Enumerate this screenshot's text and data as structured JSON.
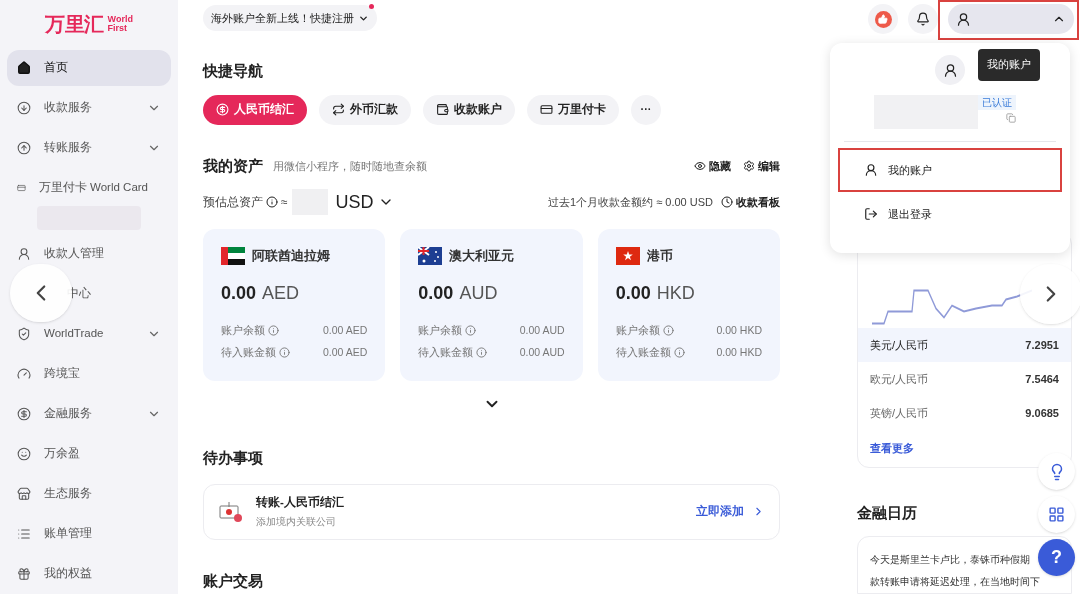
{
  "logo": {
    "brand": "万里汇",
    "sub_lines": [
      "World",
      "First"
    ]
  },
  "sidebar": {
    "items": [
      {
        "label": "首页",
        "kind": "plain",
        "selected": true,
        "expandable": false
      },
      {
        "label": "收款服务",
        "kind": "plain",
        "selected": false,
        "expandable": true
      },
      {
        "label": "转账服务",
        "kind": "plain",
        "selected": false,
        "expandable": true
      },
      {
        "label": "万里付卡 World Card",
        "kind": "redacted",
        "selected": false,
        "expandable": false
      },
      {
        "label": "收款人管理",
        "kind": "plain",
        "selected": false,
        "expandable": false
      },
      {
        "label": "中心",
        "kind": "covered",
        "selected": false,
        "expandable": false
      },
      {
        "label": "WorldTrade",
        "kind": "plain",
        "selected": false,
        "expandable": true
      },
      {
        "label": "跨境宝",
        "kind": "plain",
        "selected": false,
        "expandable": false
      },
      {
        "label": "金融服务",
        "kind": "plain",
        "selected": false,
        "expandable": true
      },
      {
        "label": "万余盈",
        "kind": "plain",
        "selected": false,
        "expandable": false
      },
      {
        "label": "生态服务",
        "kind": "plain",
        "selected": false,
        "expandable": false
      },
      {
        "label": "账单管理",
        "kind": "plain",
        "selected": false,
        "expandable": false
      },
      {
        "label": "我的权益",
        "kind": "plain",
        "selected": false,
        "expandable": false
      }
    ]
  },
  "notice": {
    "text": "海外账户全新上线！快捷注册",
    "unread": true
  },
  "account_menu": {
    "expanded": true,
    "tooltip": "我的账户",
    "verified": "已认证",
    "items": [
      {
        "label": "我的账户",
        "highlighted": true
      },
      {
        "label": "退出登录",
        "highlighted": false
      }
    ]
  },
  "quick_nav": {
    "title": "快捷导航",
    "more": "···",
    "items": [
      {
        "label": "人民币结汇",
        "selected": true
      },
      {
        "label": "外币汇款",
        "selected": false
      },
      {
        "label": "收款账户",
        "selected": false
      },
      {
        "label": "万里付卡",
        "selected": false
      }
    ]
  },
  "assets": {
    "title": "我的资产",
    "hint": "用微信小程序，随时随地查余额",
    "actions": [
      "隐藏",
      "编辑"
    ],
    "total_label": "预估总资产",
    "approx": "≈",
    "currency": "USD",
    "monthly": "过去1个月收款金额约 ≈ 0.00 USD",
    "dashboard": "收款看板",
    "cards": [
      {
        "name": "阿联酋迪拉姆",
        "amount": "0.00",
        "code": "AED",
        "rows": [
          {
            "label": "账户余额",
            "value": "0.00 AED"
          },
          {
            "label": "待入账金额",
            "value": "0.00 AED"
          }
        ]
      },
      {
        "name": "澳大利亚元",
        "amount": "0.00",
        "code": "AUD",
        "rows": [
          {
            "label": "账户余额",
            "value": "0.00 AUD"
          },
          {
            "label": "待入账金额",
            "value": "0.00 AUD"
          }
        ]
      },
      {
        "name": "港币",
        "amount": "0.00",
        "code": "HKD",
        "rows": [
          {
            "label": "账户余额",
            "value": "0.00 HKD"
          },
          {
            "label": "待入账金额",
            "value": "0.00 HKD"
          }
        ]
      }
    ]
  },
  "todo": {
    "title": "待办事项",
    "items": [
      {
        "title": "转账-人民币结汇",
        "subtitle": "添加境内关联公司",
        "action": "立即添加"
      }
    ]
  },
  "transactions": {
    "title": "账户交易"
  },
  "rates": {
    "more": "查看更多",
    "rows": [
      {
        "pair": "美元/人民币",
        "value": "7.2951",
        "selected": true
      },
      {
        "pair": "欧元/人民币",
        "value": "7.5464",
        "selected": false
      },
      {
        "pair": "英镑/人民币",
        "value": "9.0685",
        "selected": false
      }
    ]
  },
  "calendar": {
    "title": "金融日历",
    "lines": [
      "今天是斯里兰卡卢比，泰铢币种假期",
      "款转账申请将延迟处理，在当地时间下"
    ]
  },
  "help": {
    "label": "?"
  }
}
